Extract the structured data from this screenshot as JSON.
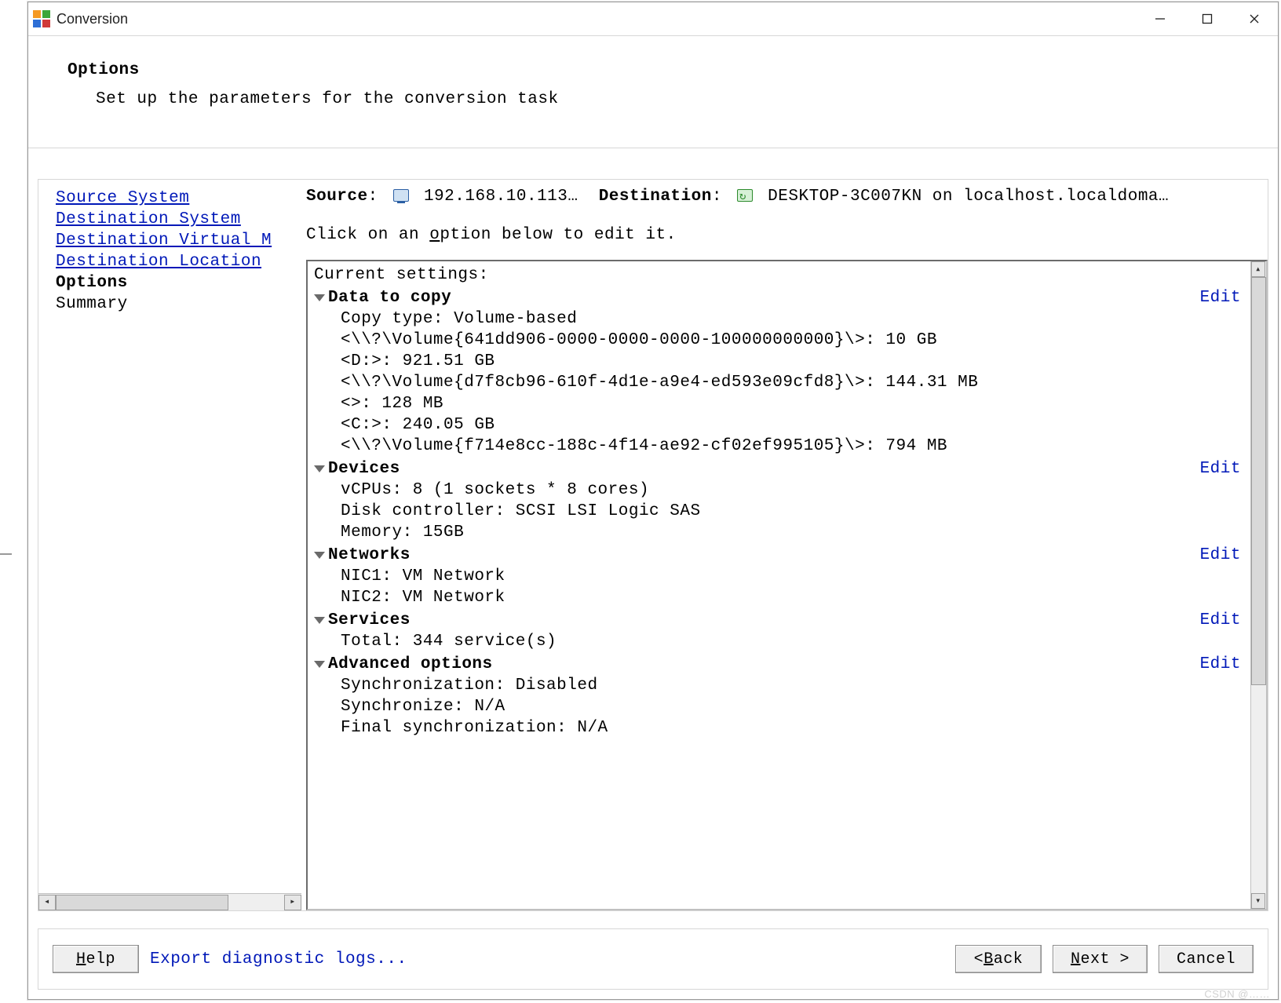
{
  "window": {
    "title": "Conversion",
    "minimize_tooltip": "Minimize",
    "maximize_tooltip": "Maximize",
    "close_tooltip": "Close"
  },
  "header": {
    "title": "Options",
    "subtitle": "Set up the parameters for the conversion task"
  },
  "nav": {
    "items": [
      {
        "label": "Source System",
        "kind": "link"
      },
      {
        "label": "Destination System",
        "kind": "link"
      },
      {
        "label": "Destination Virtual M",
        "kind": "link"
      },
      {
        "label": "Destination Location",
        "kind": "link"
      },
      {
        "label": "Options",
        "kind": "current"
      },
      {
        "label": "Summary",
        "kind": "plain"
      }
    ]
  },
  "srcdest": {
    "source_label": "Source",
    "source_value": "192.168.10.113…",
    "destination_label": "Destination",
    "destination_value": "DESKTOP-3C007KN on localhost.localdoma…"
  },
  "instruction": {
    "pre": "Click on an ",
    "underlined": "o",
    "post": "ption below to edit it."
  },
  "settings": {
    "heading": "Current settings:",
    "edit_label": "Edit",
    "sections": [
      {
        "title": "Data to copy",
        "lines": [
          "Copy type: Volume-based",
          "<\\\\?\\Volume{641dd906-0000-0000-0000-100000000000}\\>: 10 GB",
          "<D:>: 921.51 GB",
          "<\\\\?\\Volume{d7f8cb96-610f-4d1e-a9e4-ed593e09cfd8}\\>: 144.31 MB",
          "<>: 128 MB",
          "<C:>: 240.05 GB",
          "<\\\\?\\Volume{f714e8cc-188c-4f14-ae92-cf02ef995105}\\>: 794 MB"
        ]
      },
      {
        "title": "Devices",
        "lines": [
          "vCPUs: 8 (1 sockets * 8 cores)",
          "Disk controller: SCSI LSI Logic SAS",
          "Memory: 15GB"
        ]
      },
      {
        "title": "Networks",
        "lines": [
          "NIC1: VM Network",
          "NIC2: VM Network"
        ]
      },
      {
        "title": "Services",
        "lines": [
          "Total: 344 service(s)"
        ]
      },
      {
        "title": "Advanced options",
        "lines": [
          "Synchronization: Disabled",
          "Synchronize: N/A",
          "Final synchronization: N/A"
        ]
      }
    ]
  },
  "footer": {
    "help": "elp",
    "help_ul": "H",
    "export": "Export diagnostic logs...",
    "back_pre": "< ",
    "back_ul": "B",
    "back_post": "ack",
    "next_ul": "N",
    "next_post": "ext >",
    "cancel": "Cancel"
  },
  "watermark": "CSDN @……"
}
